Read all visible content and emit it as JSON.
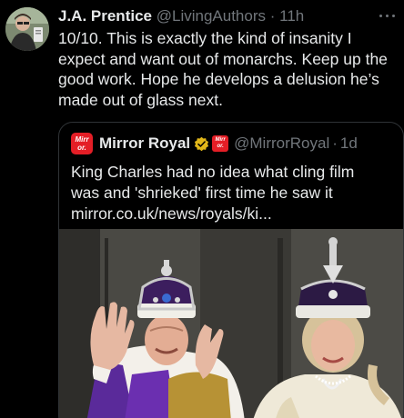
{
  "author": {
    "display_name": "J.A. Prentice",
    "handle": "@LivingAuthors",
    "separator": "·",
    "time": "11h",
    "avatar_icon": "user-avatar"
  },
  "tweet": {
    "text": "10/10. This is exactly the kind of insanity I expect and want out of monarchs. Keep up the good work. Hope he develops a delusion he’s made out of glass next."
  },
  "quote": {
    "logo_line1": "Mirr",
    "logo_line2": "or.",
    "display_name": "Mirror Royal",
    "verified_icon": "verified-badge-gold",
    "handle": "@MirrorRoyal",
    "separator": "·",
    "time": "1d",
    "text_line1": "King Charles had no idea what cling film",
    "text_line2": "was and 'shrieked' first time he saw it",
    "link": "mirror.co.uk/news/royals/ki...",
    "image_description_icon": "photo"
  },
  "colors": {
    "background": "#000000",
    "text": "#e7e9ea",
    "muted": "#71767b",
    "border": "#2f3336",
    "mirror_red": "#e41e26",
    "gold_badge": "#e2b719"
  }
}
